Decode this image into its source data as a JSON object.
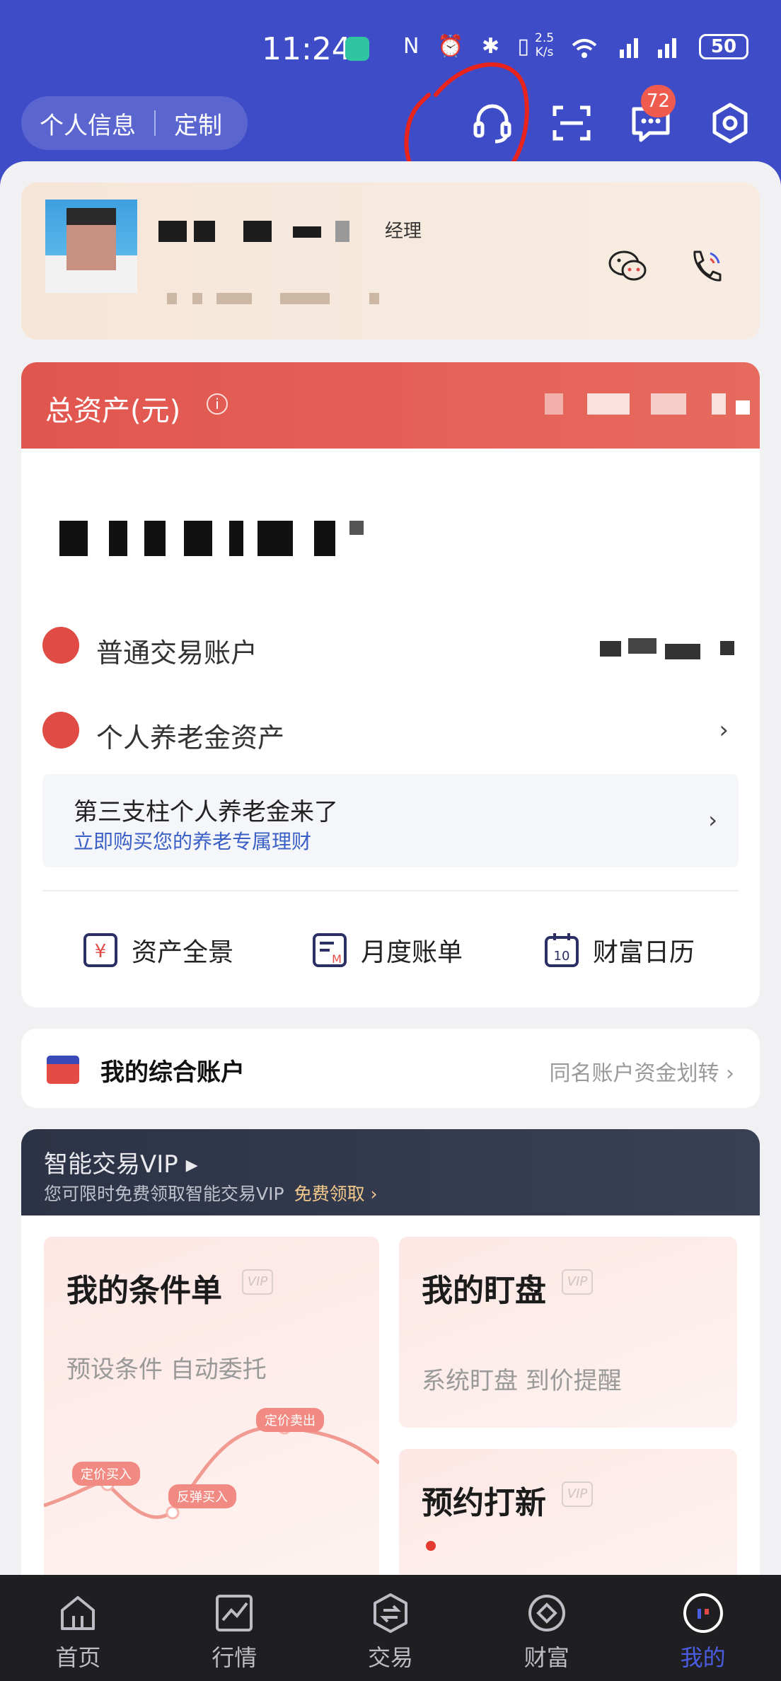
{
  "status_bar": {
    "time": "11:24",
    "network_speed": "2.5\nK/s",
    "battery": "50"
  },
  "header": {
    "segment_left": "个人信息",
    "segment_right": "定制",
    "message_count": "72",
    "icons": [
      "customer-service-icon",
      "scan-icon",
      "message-icon",
      "settings-icon"
    ]
  },
  "manager_card": {
    "role_suffix": "经理",
    "icons": [
      "wechat-icon",
      "phone-icon"
    ]
  },
  "assets": {
    "title": "总资产(元)",
    "info_icon": "i",
    "rows": [
      {
        "label": "普通交易账户",
        "icon": "diamond-icon"
      },
      {
        "label": "个人养老金资产",
        "icon": "double-diamond-icon",
        "chevron": "›"
      }
    ],
    "promo": {
      "title": "第三支柱个人养老金来了",
      "subtitle": "立即购买您的养老专属理财",
      "chevron": "›"
    },
    "quick_links": [
      {
        "label": "资产全景",
        "icon": "yuan-icon"
      },
      {
        "label": "月度账单",
        "icon": "bill-icon"
      },
      {
        "label": "财富日历",
        "icon": "calendar-icon",
        "icon_text": "10"
      }
    ]
  },
  "combined_account": {
    "title": "我的综合账户",
    "action": "同名账户资金划转 ›"
  },
  "vip": {
    "title": "智能交易VIP ▸",
    "subtitle": "您可限时免费领取智能交易VIP",
    "free_link": "免费领取 ›",
    "cards": [
      {
        "title": "我的条件单",
        "subtitle": "预设条件 自动委托",
        "tags": [
          "定价买入",
          "反弹买入",
          "定价卖出"
        ]
      },
      {
        "title": "我的盯盘",
        "subtitle": "系统盯盘 到价提醒"
      },
      {
        "title": "预约打新"
      }
    ],
    "vip_tag": "VIP"
  },
  "tabbar": {
    "tabs": [
      {
        "label": "首页",
        "icon": "home-icon"
      },
      {
        "label": "行情",
        "icon": "chart-icon"
      },
      {
        "label": "交易",
        "icon": "trade-icon"
      },
      {
        "label": "财富",
        "icon": "wealth-icon"
      },
      {
        "label": "我的",
        "icon": "profile-icon",
        "active": true
      }
    ]
  },
  "colors": {
    "header_blue": "#3f4cc8",
    "accent_red": "#e1564f",
    "active_tab": "#4a5ce0",
    "annotation_red": "#e8241c"
  }
}
